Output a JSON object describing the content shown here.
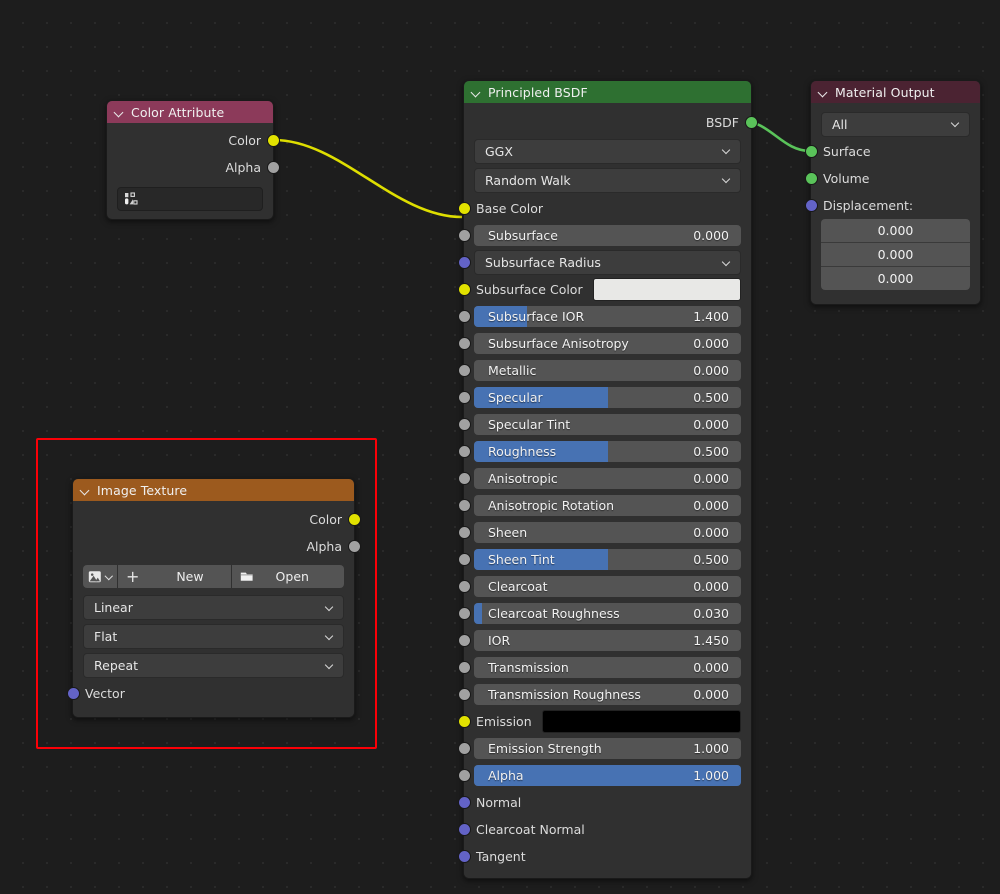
{
  "app": {
    "editor": "blender-shader-node-editor"
  },
  "theme": {
    "background": "#1d1d1d",
    "node_body": "#303030",
    "header_attribute": "#8c3a5a",
    "header_shader": "#2e7031",
    "header_output": "#4b2332",
    "header_texture": "#9c5a1e",
    "slider_fill": "#4772b3",
    "socket_color": "#e2e200",
    "socket_shader": "#5ac35a",
    "socket_vector": "#6363c7",
    "socket_value": "#a1a1a1",
    "annotation": "#fb0007"
  },
  "annotation": {
    "name": "red-highlight-rectangle",
    "target": "image-texture-node"
  },
  "nodes": {
    "color_attribute": {
      "title": "Color Attribute",
      "outputs": [
        {
          "label": "Color",
          "socket": "color"
        },
        {
          "label": "Alpha",
          "socket": "value"
        }
      ],
      "attribute_field": {
        "value": "",
        "icon": "vertex-color-icon"
      }
    },
    "principled_bsdf": {
      "title": "Principled BSDF",
      "output": {
        "label": "BSDF",
        "socket": "shader"
      },
      "distribution": "GGX",
      "subsurface_method": "Random Walk",
      "inputs": [
        {
          "label": "Base Color",
          "type": "socket_only",
          "socket": "color"
        },
        {
          "label": "Subsurface",
          "type": "slider",
          "value": "0.000",
          "fill": 0,
          "socket": "value"
        },
        {
          "label": "Subsurface Radius",
          "type": "dropdown",
          "socket": "vector"
        },
        {
          "label": "Subsurface Color",
          "type": "color",
          "swatch": "#e8e8e6",
          "socket": "color"
        },
        {
          "label": "Subsurface IOR",
          "type": "slider",
          "value": "1.400",
          "fill": 20,
          "socket": "value"
        },
        {
          "label": "Subsurface Anisotropy",
          "type": "slider",
          "value": "0.000",
          "fill": 0,
          "socket": "value"
        },
        {
          "label": "Metallic",
          "type": "slider",
          "value": "0.000",
          "fill": 0,
          "socket": "value"
        },
        {
          "label": "Specular",
          "type": "slider",
          "value": "0.500",
          "fill": 50,
          "socket": "value"
        },
        {
          "label": "Specular Tint",
          "type": "slider",
          "value": "0.000",
          "fill": 0,
          "socket": "value"
        },
        {
          "label": "Roughness",
          "type": "slider",
          "value": "0.500",
          "fill": 50,
          "socket": "value"
        },
        {
          "label": "Anisotropic",
          "type": "slider",
          "value": "0.000",
          "fill": 0,
          "socket": "value"
        },
        {
          "label": "Anisotropic Rotation",
          "type": "slider",
          "value": "0.000",
          "fill": 0,
          "socket": "value"
        },
        {
          "label": "Sheen",
          "type": "slider",
          "value": "0.000",
          "fill": 0,
          "socket": "value"
        },
        {
          "label": "Sheen Tint",
          "type": "slider",
          "value": "0.500",
          "fill": 50,
          "socket": "value"
        },
        {
          "label": "Clearcoat",
          "type": "slider",
          "value": "0.000",
          "fill": 0,
          "socket": "value"
        },
        {
          "label": "Clearcoat Roughness",
          "type": "slider",
          "value": "0.030",
          "fill": 3,
          "socket": "value"
        },
        {
          "label": "IOR",
          "type": "slider",
          "value": "1.450",
          "fill": 0,
          "socket": "value"
        },
        {
          "label": "Transmission",
          "type": "slider",
          "value": "0.000",
          "fill": 0,
          "socket": "value"
        },
        {
          "label": "Transmission Roughness",
          "type": "slider",
          "value": "0.000",
          "fill": 0,
          "socket": "value"
        },
        {
          "label": "Emission",
          "type": "color",
          "swatch": "#000000",
          "socket": "color"
        },
        {
          "label": "Emission Strength",
          "type": "slider",
          "value": "1.000",
          "fill": 0,
          "socket": "value"
        },
        {
          "label": "Alpha",
          "type": "slider",
          "value": "1.000",
          "fill": 100,
          "socket": "value"
        },
        {
          "label": "Normal",
          "type": "socket_only",
          "socket": "vector"
        },
        {
          "label": "Clearcoat Normal",
          "type": "socket_only",
          "socket": "vector"
        },
        {
          "label": "Tangent",
          "type": "socket_only",
          "socket": "vector"
        }
      ]
    },
    "material_output": {
      "title": "Material Output",
      "target": "All",
      "inputs": [
        {
          "label": "Surface",
          "socket": "shader"
        },
        {
          "label": "Volume",
          "socket": "shader"
        },
        {
          "label": "Displacement:",
          "socket": "vector"
        }
      ],
      "displacement_values": [
        "0.000",
        "0.000",
        "0.000"
      ]
    },
    "image_texture": {
      "title": "Image Texture",
      "outputs": [
        {
          "label": "Color",
          "socket": "color"
        },
        {
          "label": "Alpha",
          "socket": "value"
        }
      ],
      "image_selector": {
        "browse_icon": "image-browse-icon",
        "new_label": "New",
        "open_label": "Open",
        "plus_icon": "plus-icon",
        "folder_icon": "folder-icon"
      },
      "interpolation": "Linear",
      "projection": "Flat",
      "extension": "Repeat",
      "inputs": [
        {
          "label": "Vector",
          "socket": "vector"
        }
      ]
    }
  },
  "links": [
    {
      "from": "color-attribute.Color",
      "to": "principled-bsdf.Base Color",
      "color": "#dede00"
    },
    {
      "from": "principled-bsdf.BSDF",
      "to": "material-output.Surface",
      "color": "#5ac35a"
    }
  ]
}
